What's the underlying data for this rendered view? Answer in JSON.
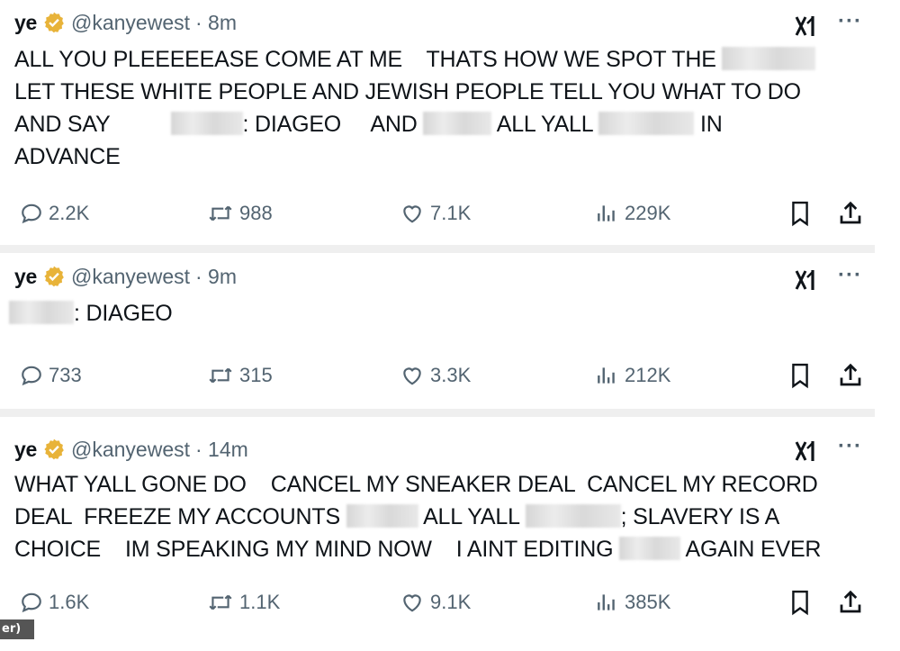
{
  "posts": [
    {
      "name": "ye",
      "handle": "@kanyewest",
      "time": "· 8m",
      "text_parts": [
        "ALL YOU PLEEEEEASE COME AT ME    THATS HOW WE SPOT THE",
        "LET THESE WHITE PEOPLE AND JEWISH PEOPLE TELL YOU WHAT TO DO",
        "AND SAY",
        "DIAGEO     AND",
        "ALL YALL",
        "IN",
        "ADVANCE"
      ],
      "stats": {
        "replies": "2.2K",
        "reposts": "988",
        "likes": "7.1K",
        "views": "229K"
      }
    },
    {
      "name": "ye",
      "handle": "@kanyewest",
      "time": "· 9m",
      "text_parts": [
        "DIAGEO"
      ],
      "stats": {
        "replies": "733",
        "reposts": "315",
        "likes": "3.3K",
        "views": "212K"
      }
    },
    {
      "name": "ye",
      "handle": "@kanyewest",
      "time": "· 14m",
      "text_parts": [
        "WHAT YALL GONE DO    CANCEL MY SNEAKER DEAL  CANCEL MY RECORD",
        "DEAL  FREEZE MY ACCOUNTS",
        "ALL YALL",
        "SLAVERY IS A",
        "CHOICE    IM SPEAKING MY MIND NOW    I AINT EDITING",
        "AGAIN EVER"
      ],
      "stats": {
        "replies": "1.6K",
        "reposts": "1.1K",
        "likes": "9.1K",
        "views": "385K"
      }
    }
  ],
  "footer_tag": "er)",
  "colors": {
    "verified_gold": "#e8b339",
    "text": "#0f1419",
    "muted": "#536471"
  },
  "icons": [
    "verified-badge-icon",
    "grok-icon",
    "more-icon",
    "reply-icon",
    "repost-icon",
    "like-icon",
    "views-icon",
    "bookmark-icon",
    "share-icon"
  ]
}
